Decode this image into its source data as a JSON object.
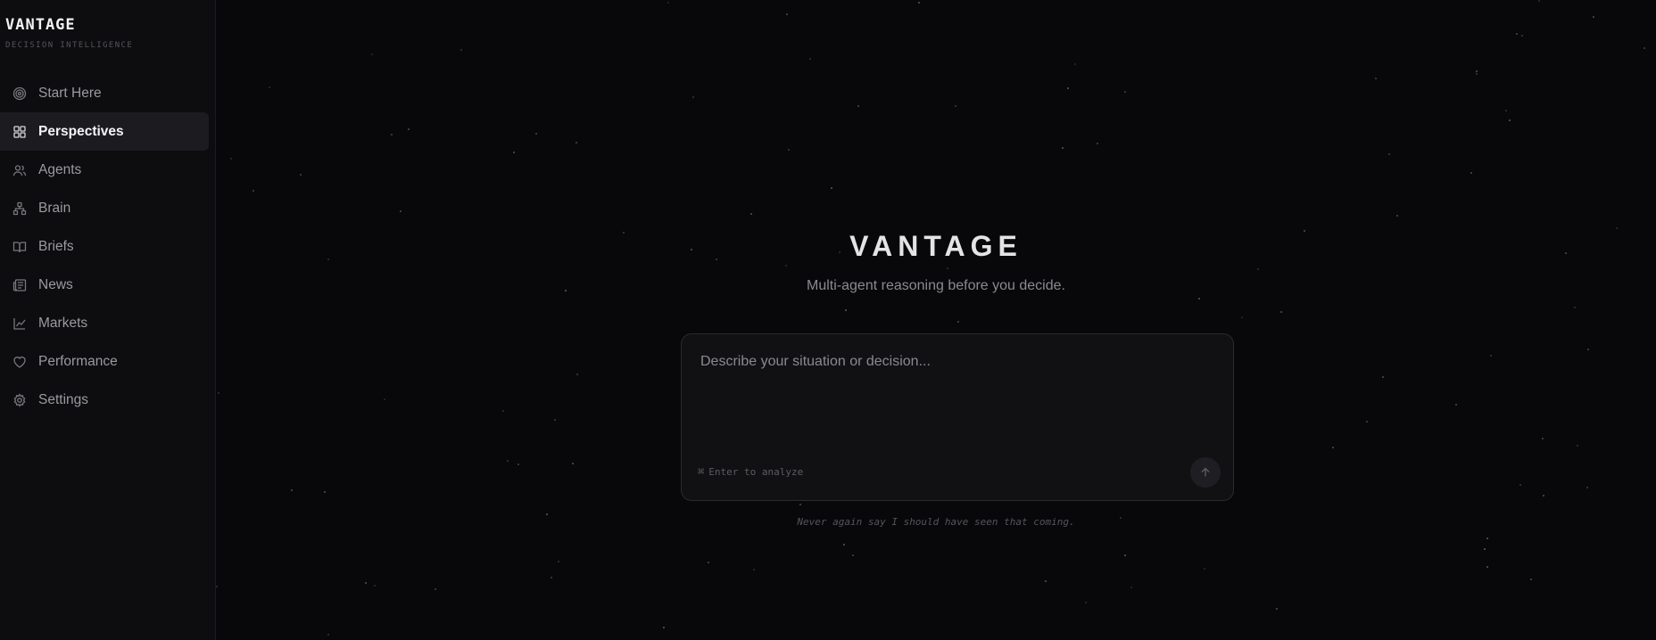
{
  "brand": {
    "title": "VANTAGE",
    "subtitle": "DECISION INTELLIGENCE"
  },
  "sidebar": {
    "items": [
      {
        "label": "Start Here",
        "icon": "target-icon",
        "active": false
      },
      {
        "label": "Perspectives",
        "icon": "grid-icon",
        "active": true
      },
      {
        "label": "Agents",
        "icon": "users-icon",
        "active": false
      },
      {
        "label": "Brain",
        "icon": "network-icon",
        "active": false
      },
      {
        "label": "Briefs",
        "icon": "book-open-icon",
        "active": false
      },
      {
        "label": "News",
        "icon": "newspaper-icon",
        "active": false
      },
      {
        "label": "Markets",
        "icon": "line-chart-icon",
        "active": false
      },
      {
        "label": "Performance",
        "icon": "heart-icon",
        "active": false
      },
      {
        "label": "Settings",
        "icon": "gear-icon",
        "active": false
      }
    ]
  },
  "hero": {
    "title": "VANTAGE",
    "subtitle": "Multi-agent reasoning before you decide."
  },
  "composer": {
    "placeholder": "Describe your situation or decision...",
    "value": "",
    "hint_icon": "command-key-icon",
    "hint": "Enter to analyze",
    "submit_icon": "arrow-up-icon"
  },
  "tagline": "Never again say I should have seen that coming.",
  "colors": {
    "background": "#08080a",
    "sidebar": "#0d0d0f",
    "active_item": "#1c1c20",
    "composer": "#111113"
  }
}
